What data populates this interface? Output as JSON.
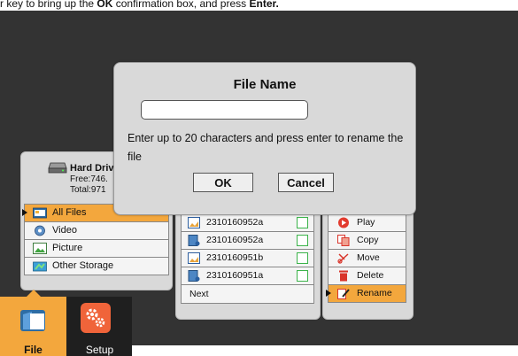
{
  "caption": {
    "pre": "r key to bring up the ",
    "bold1": "OK",
    "mid": " confirmation box, and press ",
    "bold2": "Enter."
  },
  "storage": {
    "drive_name": "Hard Driv",
    "free": "Free:746.",
    "total": "Total:971",
    "categories": [
      {
        "label": "All Files",
        "icon": "folder-icon",
        "active": true
      },
      {
        "label": "Video",
        "icon": "video-icon"
      },
      {
        "label": "Picture",
        "icon": "picture-icon"
      },
      {
        "label": "Other Storage",
        "icon": "other-storage-icon"
      }
    ]
  },
  "files": {
    "rows": [
      {
        "name": "2310160952a",
        "icon": "picture-file-icon"
      },
      {
        "name": "2310160952a",
        "icon": "video-file-icon"
      },
      {
        "name": "2310160951b",
        "icon": "picture-file-icon"
      },
      {
        "name": "2310160951a",
        "icon": "video-file-icon"
      }
    ],
    "next_label": "Next"
  },
  "actions": [
    {
      "label": "Play",
      "icon": "play-icon"
    },
    {
      "label": "Copy",
      "icon": "copy-icon"
    },
    {
      "label": "Move",
      "icon": "scissors-icon"
    },
    {
      "label": "Delete",
      "icon": "trash-icon"
    },
    {
      "label": "Rename",
      "icon": "rename-icon",
      "active": true
    }
  ],
  "nav": {
    "file_label": "File",
    "setup_label": "Setup"
  },
  "dialog": {
    "title": "File Name",
    "input_value": "",
    "message": "Enter up to 20 characters and press enter to rename the file",
    "ok_label": "OK",
    "cancel_label": "Cancel"
  },
  "colors": {
    "accent": "#f3a73d",
    "background": "#333333",
    "panel": "#d9d9d9"
  }
}
